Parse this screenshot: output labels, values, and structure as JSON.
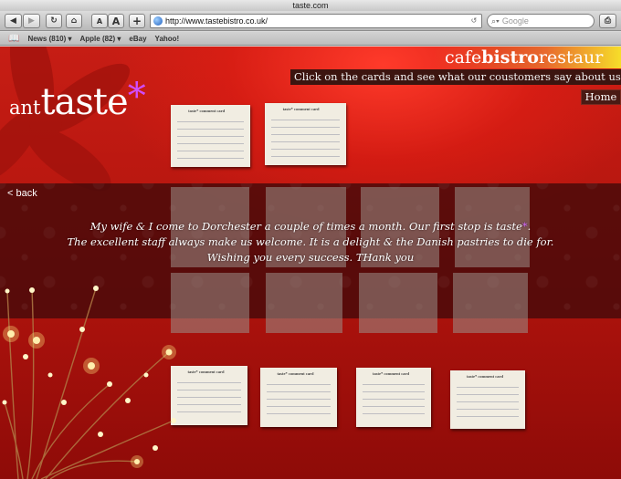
{
  "browser": {
    "window_title": "taste.com",
    "url": "http://www.tastebistro.co.uk/",
    "search_placeholder": "Google",
    "buttons": {
      "text_smaller": "A",
      "text_larger": "A",
      "add": "+"
    }
  },
  "bookmarks": [
    {
      "label": "News (810) ▾"
    },
    {
      "label": "Apple (82) ▾"
    },
    {
      "label": "eBay"
    },
    {
      "label": "Yahoo!"
    }
  ],
  "site": {
    "logo": {
      "prefix": "ant",
      "name": "taste",
      "star": "*"
    },
    "brand": {
      "pre": "cafe",
      "bold": "bistro",
      "post": "restaur"
    },
    "instruction": "Click on the cards and see what our coustomers say about us.",
    "home": "Home",
    "back": "< back",
    "card_header": "taste* comment card",
    "review": {
      "line1_pre": "My wife & I come to Dorchester a couple of times a month. Our first stop is taste",
      "line1_star": "*",
      "line1_post": ".",
      "line2": "The excellent staff always make us welcome. It is a delight & the Danish pastries to die for.",
      "line3": "Wishing you every success. THank you"
    }
  },
  "colors": {
    "accent_purple": "#d04dff",
    "page_red": "#c61d14"
  }
}
